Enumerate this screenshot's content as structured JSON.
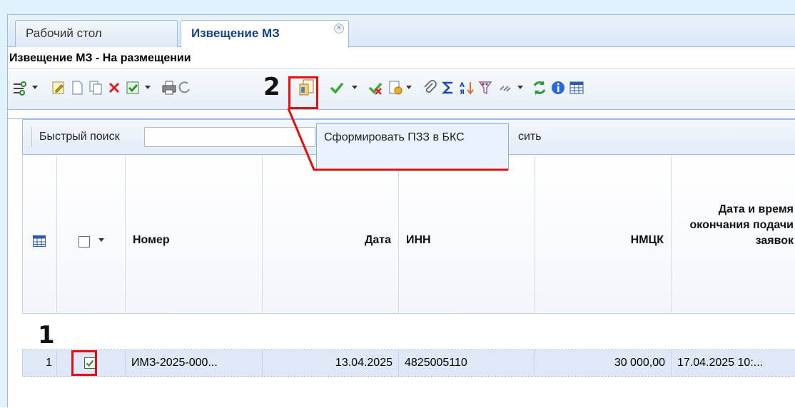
{
  "tabs": [
    {
      "label": "Рабочий стол",
      "active": false
    },
    {
      "label": "Извещение МЗ",
      "active": true
    }
  ],
  "panel_title": "Извещение МЗ - На размещении",
  "toolbar": {
    "icons": [
      "select-icon",
      "edit-icon",
      "new-document-icon",
      "copy-icon",
      "delete-icon",
      "approve-icon",
      "print-icon",
      "refresh-small-icon",
      "form-pzz-icon",
      "check-icon",
      "reject-icon",
      "document-action-icon",
      "attach-icon",
      "sum-icon",
      "sort-icon",
      "filter-icon",
      "links-icon",
      "refresh-icon",
      "info-icon",
      "table-settings-icon"
    ]
  },
  "markers": {
    "first": "1",
    "second": "2"
  },
  "tooltip": {
    "text": "Сформировать ПЗЗ в БКС"
  },
  "search": {
    "label": "Быстрый поиск",
    "placeholder": "",
    "clear_label": "сить"
  },
  "columns": [
    {
      "label": "Номер"
    },
    {
      "label": "Дата"
    },
    {
      "label": "ИНН"
    },
    {
      "label": "НМЦК"
    },
    {
      "label": "Дата и время окончания подачи заявок"
    }
  ],
  "rows": [
    {
      "index": "1",
      "checked": true,
      "number": "ИМЗ-2025-000...",
      "date": "13.04.2025",
      "inn": "4825005110",
      "nmck": "30 000,00",
      "deadline": "17.04.2025 10:..."
    }
  ],
  "colors": {
    "accent": "#15428b",
    "highlight": "#e01010",
    "selected_row": "#dfe8f6"
  }
}
